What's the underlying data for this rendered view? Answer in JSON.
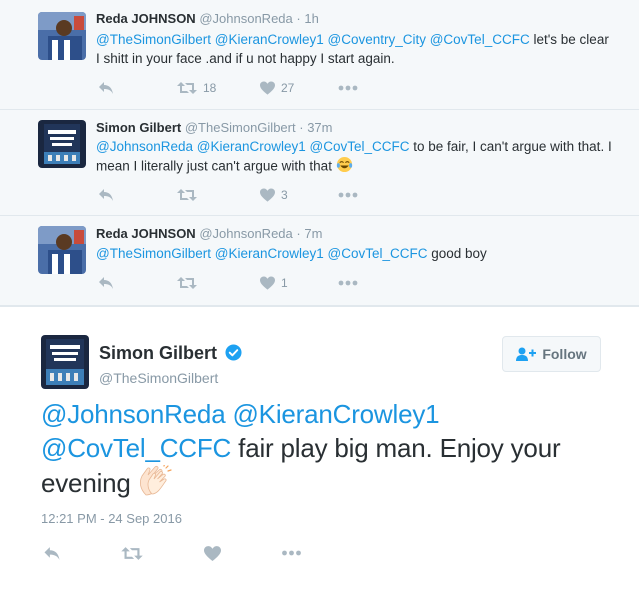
{
  "colors": {
    "mention": "#1b95e0",
    "muted": "#8899a6",
    "icon": "#aab8c2",
    "verified": "#1da1f2",
    "reply_bg": "#f5f8fa"
  },
  "replies": [
    {
      "fullname": "Reda JOHNSON",
      "handle": "@JohnsonReda",
      "sep": "·",
      "time": "1h",
      "mentions": "@TheSimonGilbert @KieranCrowley1 @Coventry_City @CovTel_CCFC",
      "text": "  let's be clear I shitt in your face .and if u not happy I start again.",
      "retweets": "18",
      "likes": "27"
    },
    {
      "fullname": "Simon Gilbert",
      "handle": "@TheSimonGilbert",
      "sep": "·",
      "time": "37m",
      "mentions": "@JohnsonReda @KieranCrowley1 @CovTel_CCFC",
      "text": " to be fair, I can't argue with that. I mean I literally just can't argue with that ",
      "retweets": "",
      "likes": "3"
    },
    {
      "fullname": "Reda JOHNSON",
      "handle": "@JohnsonReda",
      "sep": "·",
      "time": "7m",
      "mentions": "@TheSimonGilbert @KieranCrowley1 @CovTel_CCFC",
      "text": " good boy",
      "retweets": "",
      "likes": "1"
    }
  ],
  "main_tweet": {
    "fullname": "Simon Gilbert",
    "handle": "@TheSimonGilbert",
    "follow_label": "Follow",
    "mention1": "@JohnsonReda",
    "mention2": "@KieranCrowley1",
    "mention3": "@CovTel_CCFC",
    "text": " fair play big man. Enjoy your evening ",
    "timestamp": "12:21 PM - 24 Sep 2016"
  },
  "icons": {
    "reply": "reply-icon",
    "retweet": "retweet-icon",
    "like": "heart-icon",
    "more": "more-icon",
    "verified": "verified-badge-icon",
    "follow": "follow-user-icon",
    "laugh": "tears-of-joy-emoji",
    "clap": "clapping-hands-emoji"
  }
}
